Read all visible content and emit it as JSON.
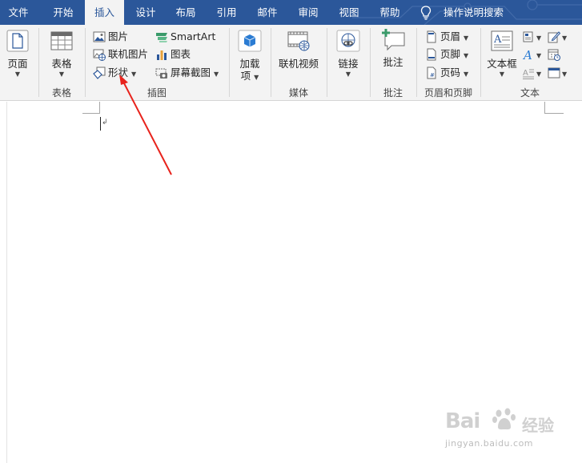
{
  "tabs": [
    {
      "label": "文件"
    },
    {
      "label": "开始"
    },
    {
      "label": "插入",
      "active": true
    },
    {
      "label": "设计"
    },
    {
      "label": "布局"
    },
    {
      "label": "引用"
    },
    {
      "label": "邮件"
    },
    {
      "label": "审阅"
    },
    {
      "label": "视图"
    },
    {
      "label": "帮助"
    }
  ],
  "tell_me": {
    "label": "操作说明搜索",
    "icon": "lightbulb-icon"
  },
  "ribbon": {
    "pages": {
      "label": "页面"
    },
    "table": {
      "button": "表格",
      "group": "表格"
    },
    "illustrations": {
      "picture": "图片",
      "online_picture": "联机图片",
      "shapes": "形状",
      "smartart": "SmartArt",
      "chart": "图表",
      "screenshot": "屏幕截图",
      "group": "插图"
    },
    "addins": {
      "line1": "加载",
      "line2": "项"
    },
    "media": {
      "button": "联机视频",
      "group": "媒体"
    },
    "links": {
      "button": "链接"
    },
    "comments": {
      "button": "批注",
      "group": "批注"
    },
    "header_footer": {
      "header": "页眉",
      "footer": "页脚",
      "page_number": "页码",
      "group": "页眉和页脚"
    },
    "text": {
      "textbox": "文本框",
      "group": "文本"
    }
  },
  "document": {
    "paragraph_mark": "↲"
  },
  "watermark": {
    "brand": "Bai",
    "brand_cn": "经验",
    "url": "jingyan.baidu.com"
  },
  "colors": {
    "accent": "#2b579a",
    "ribbon_bg": "#f3f3f3",
    "annotation_arrow": "#e8231c"
  }
}
